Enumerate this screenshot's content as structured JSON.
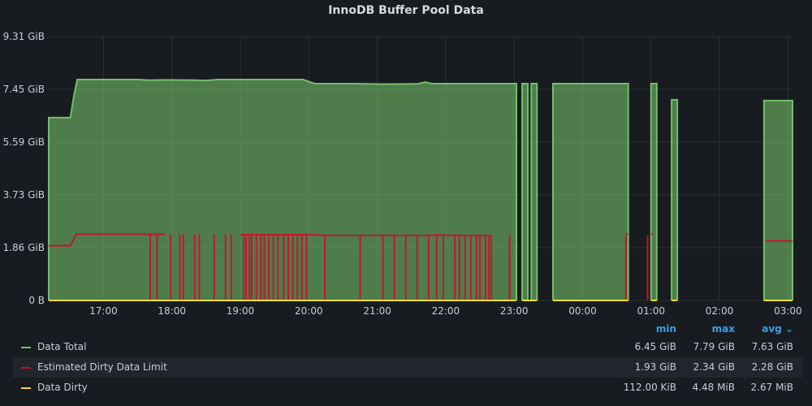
{
  "panel": {
    "title": "InnoDB Buffer Pool Data"
  },
  "chart_data": {
    "type": "area",
    "title": "InnoDB Buffer Pool Data",
    "x_ticks": [
      "17:00",
      "18:00",
      "19:00",
      "20:00",
      "21:00",
      "22:00",
      "23:00",
      "00:00",
      "01:00",
      "02:00",
      "03:00"
    ],
    "x_range": [
      "16:12",
      "03:04"
    ],
    "y_ticks": [
      "0 B",
      "1.86 GiB",
      "3.73 GiB",
      "5.59 GiB",
      "7.45 GiB",
      "9.31 GiB"
    ],
    "ylim_gib": [
      0,
      9.31
    ],
    "grid": true,
    "legend_position": "bottom",
    "series": [
      {
        "name": "Data Total",
        "color": "#73bf69",
        "fill": true,
        "unit": "GiB",
        "segments": [
          [
            [
              "16:12",
              6.45
            ],
            [
              "16:31",
              6.45
            ],
            [
              "16:34",
              7.2
            ],
            [
              "16:37",
              7.79
            ],
            [
              "17:30",
              7.79
            ],
            [
              "17:40",
              7.77
            ],
            [
              "17:55",
              7.78
            ],
            [
              "18:20",
              7.77
            ],
            [
              "18:30",
              7.76
            ],
            [
              "18:40",
              7.79
            ],
            [
              "19:55",
              7.79
            ],
            [
              "20:05",
              7.65
            ],
            [
              "20:40",
              7.65
            ],
            [
              "20:50",
              7.64
            ],
            [
              "21:05",
              7.63
            ],
            [
              "21:35",
              7.64
            ],
            [
              "21:42",
              7.7
            ],
            [
              "21:48",
              7.65
            ],
            [
              "23:02",
              7.65
            ]
          ],
          [
            [
              "23:07",
              7.65
            ],
            [
              "23:12",
              7.65
            ]
          ],
          [
            [
              "23:15",
              7.65
            ],
            [
              "23:20",
              7.65
            ]
          ],
          [
            [
              "23:34",
              7.65
            ],
            [
              "00:40",
              7.65
            ]
          ],
          [
            [
              "01:00",
              7.65
            ],
            [
              "01:05",
              7.65
            ]
          ],
          [
            [
              "01:18",
              7.08
            ],
            [
              "01:23",
              7.08
            ]
          ],
          [
            [
              "02:39",
              7.05
            ],
            [
              "03:04",
              7.05
            ]
          ]
        ]
      },
      {
        "name": "Estimated Dirty Data Limit",
        "color": "#c4162a",
        "fill": false,
        "unit": "GiB",
        "segments": [
          [
            [
              "16:12",
              1.93
            ],
            [
              "16:31",
              1.93
            ],
            [
              "16:36",
              2.34
            ],
            [
              "17:54",
              2.34
            ]
          ],
          [
            [
              "19:00",
              2.32
            ],
            [
              "20:00",
              2.32
            ],
            [
              "20:20",
              2.29
            ],
            [
              "21:40",
              2.29
            ],
            [
              "21:50",
              2.31
            ],
            [
              "22:15",
              2.29
            ],
            [
              "22:40",
              2.29
            ]
          ],
          [
            [
              "00:38",
              2.34
            ],
            [
              "00:40",
              2.34
            ]
          ],
          [
            [
              "01:00",
              2.34
            ],
            [
              "01:02",
              2.34
            ]
          ],
          [
            [
              "02:40",
              2.1
            ],
            [
              "03:04",
              2.1
            ]
          ]
        ],
        "drops": [
          "17:41",
          "17:47",
          "17:59",
          "18:07",
          "18:10",
          "18:20",
          "18:24",
          "18:37",
          "18:47",
          "18:52",
          "19:03",
          "19:05",
          "19:08",
          "19:10",
          "19:14",
          "19:18",
          "19:21",
          "19:25",
          "19:29",
          "19:33",
          "19:38",
          "19:42",
          "19:46",
          "19:50",
          "19:54",
          "19:58",
          "20:14",
          "20:45",
          "21:05",
          "21:15",
          "21:25",
          "21:35",
          "21:45",
          "21:52",
          "21:58",
          "22:08",
          "22:12",
          "22:17",
          "22:22",
          "22:27",
          "22:30",
          "22:35",
          "22:38",
          "22:40",
          "22:56"
        ],
        "spikes": [
          "22:56",
          "00:38",
          "00:57"
        ]
      },
      {
        "name": "Data Dirty",
        "color": "#fade2a",
        "fill": false,
        "unit": "GiB",
        "segments": [
          [
            [
              "16:12",
              0.001
            ],
            [
              "23:02",
              0.001
            ]
          ],
          [
            [
              "23:07",
              0.001
            ],
            [
              "23:20",
              0.001
            ]
          ],
          [
            [
              "23:34",
              0.001
            ],
            [
              "00:40",
              0.001
            ]
          ],
          [
            [
              "01:00",
              0.001
            ],
            [
              "01:05",
              0.001
            ]
          ],
          [
            [
              "01:18",
              0.001
            ],
            [
              "01:23",
              0.001
            ]
          ],
          [
            [
              "02:39",
              0.001
            ],
            [
              "03:04",
              0.001
            ]
          ]
        ]
      }
    ]
  },
  "legend": {
    "headers": {
      "min": "min",
      "max": "max",
      "avg": "avg ⌄"
    },
    "rows": [
      {
        "name": "Data Total",
        "color": "#73bf69",
        "min": "6.45 GiB",
        "max": "7.79 GiB",
        "avg": "7.63 GiB"
      },
      {
        "name": "Estimated Dirty Data Limit",
        "color": "#c4162a",
        "min": "1.93 GiB",
        "max": "2.34 GiB",
        "avg": "2.28 GiB"
      },
      {
        "name": "Data Dirty",
        "color": "#fade2a",
        "min": "112.00 KiB",
        "max": "4.48 MiB",
        "avg": "2.67 MiB"
      }
    ]
  }
}
